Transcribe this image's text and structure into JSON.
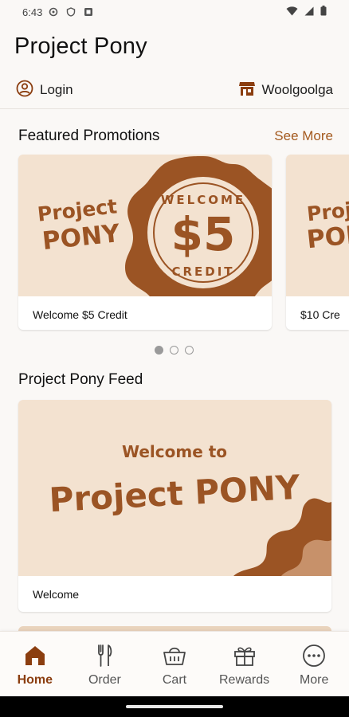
{
  "status_bar": {
    "time": "6:43",
    "icons": [
      "settings-icon",
      "shield-icon",
      "card-icon",
      "wifi-icon",
      "signal-icon",
      "battery-icon"
    ]
  },
  "app": {
    "title": "Project Pony"
  },
  "account": {
    "login_label": "Login",
    "store_label": "Woolgoolga"
  },
  "promotions": {
    "title": "Featured Promotions",
    "see_more": "See More",
    "items": [
      {
        "caption": "Welcome $5 Credit",
        "logo_line1": "Project",
        "logo_line2": "PONY",
        "badge_top": "WELCOME",
        "badge_amount": "$5",
        "badge_bottom": "CREDIT"
      },
      {
        "caption": "$10 Cre",
        "logo_line1": "Proj",
        "logo_line2": "PON"
      }
    ],
    "pager": {
      "count": 3,
      "active": 0
    }
  },
  "feed": {
    "title": "Project Pony Feed",
    "items": [
      {
        "headline": "Welcome to",
        "logo": "Project PONY",
        "caption": "Welcome"
      }
    ]
  },
  "bottom_nav": {
    "items": [
      {
        "label": "Home",
        "icon": "home-icon",
        "active": true
      },
      {
        "label": "Order",
        "icon": "cutlery-icon",
        "active": false
      },
      {
        "label": "Cart",
        "icon": "basket-icon",
        "active": false
      },
      {
        "label": "Rewards",
        "icon": "gift-icon",
        "active": false
      },
      {
        "label": "More",
        "icon": "more-icon",
        "active": false
      }
    ]
  },
  "colors": {
    "brand_brown": "#9b5424",
    "active_nav": "#8b3e10",
    "cream": "#f3e2d0",
    "background": "#faf8f6"
  }
}
